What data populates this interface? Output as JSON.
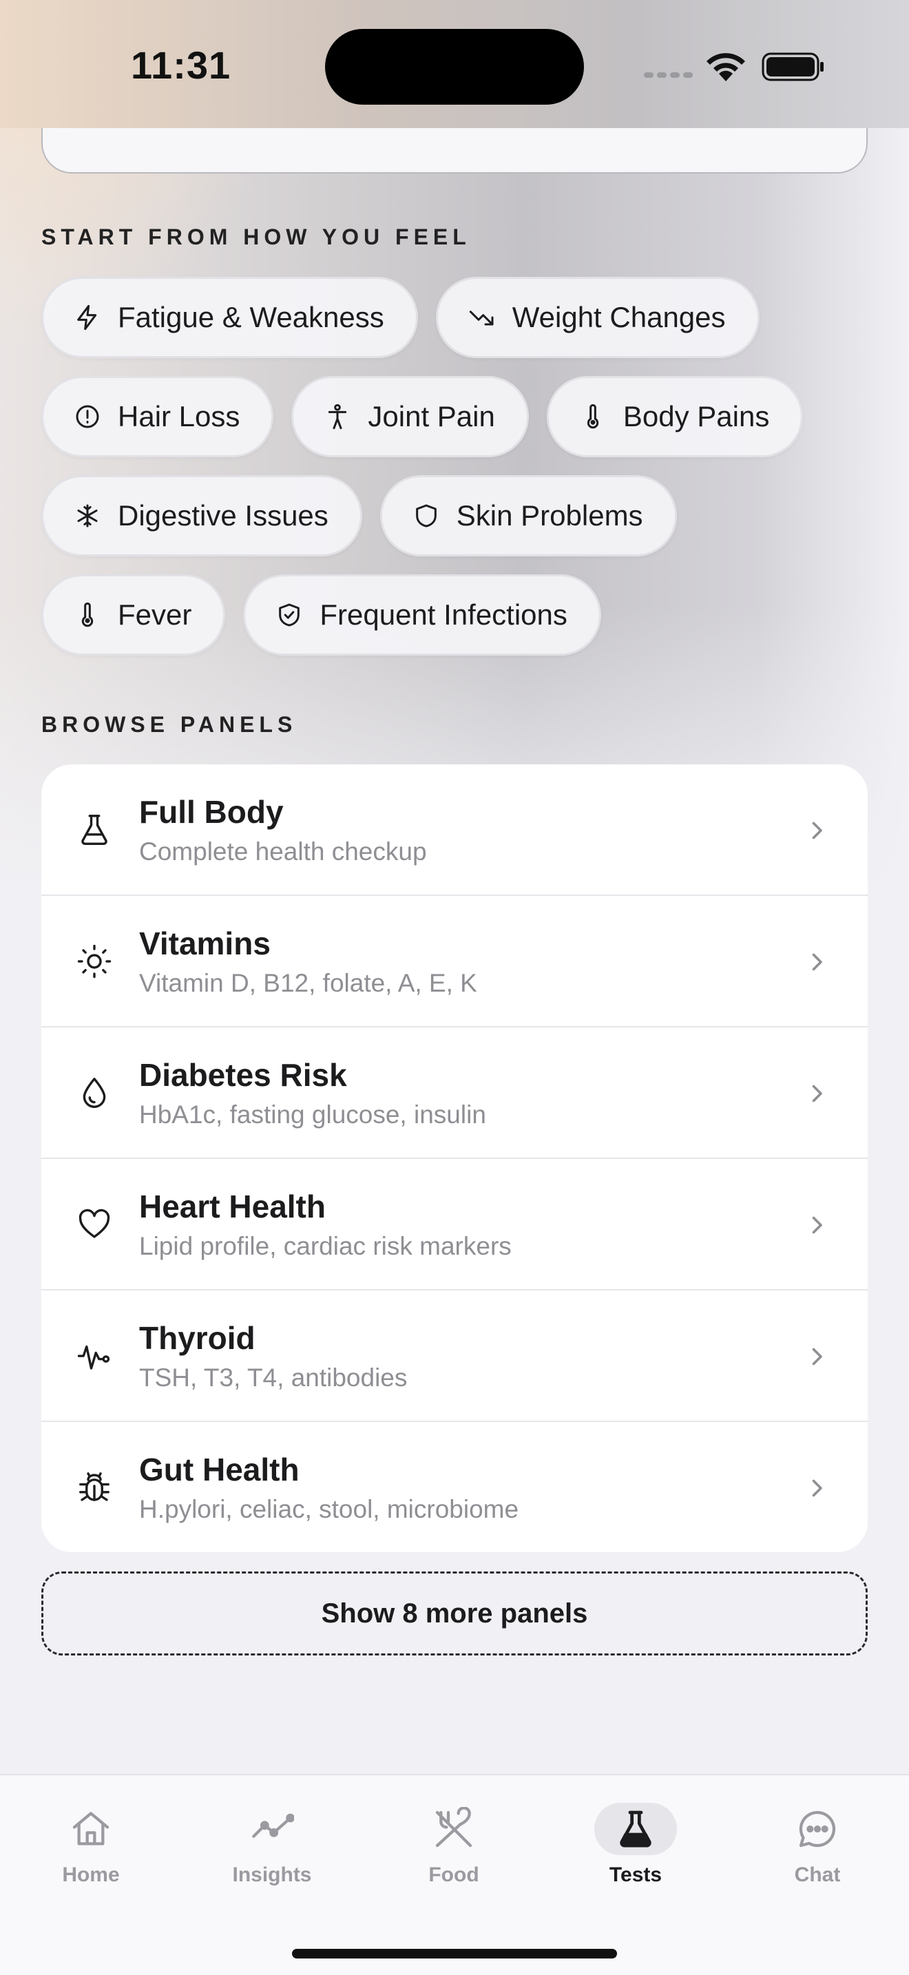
{
  "status": {
    "time": "11:31"
  },
  "symptoms": {
    "label": "START FROM HOW YOU FEEL",
    "chips": [
      {
        "label": "Fatigue & Weakness",
        "icon": "bolt-icon"
      },
      {
        "label": "Weight Changes",
        "icon": "trend-down-icon"
      },
      {
        "label": "Hair Loss",
        "icon": "alert-circle-icon"
      },
      {
        "label": "Joint Pain",
        "icon": "body-figure-icon"
      },
      {
        "label": "Body Pains",
        "icon": "thermometer-icon"
      },
      {
        "label": "Digestive Issues",
        "icon": "snowflake-icon"
      },
      {
        "label": "Skin Problems",
        "icon": "shield-icon"
      },
      {
        "label": "Fever",
        "icon": "thermometer-icon"
      },
      {
        "label": "Frequent Infections",
        "icon": "shield-check-icon"
      }
    ]
  },
  "panels": {
    "label": "BROWSE PANELS",
    "items": [
      {
        "title": "Full Body",
        "subtitle": "Complete health checkup",
        "icon": "flask-icon"
      },
      {
        "title": "Vitamins",
        "subtitle": "Vitamin D, B12, folate, A, E, K",
        "icon": "sun-icon"
      },
      {
        "title": "Diabetes Risk",
        "subtitle": "HbA1c, fasting glucose, insulin",
        "icon": "droplet-icon"
      },
      {
        "title": "Heart Health",
        "subtitle": "Lipid profile, cardiac risk markers",
        "icon": "heart-icon"
      },
      {
        "title": "Thyroid",
        "subtitle": "TSH, T3, T4, antibodies",
        "icon": "pulse-icon"
      },
      {
        "title": "Gut Health",
        "subtitle": "H.pylori, celiac, stool, microbiome",
        "icon": "bug-icon"
      }
    ],
    "more_label": "Show 8 more panels"
  },
  "tabs": [
    {
      "label": "Home",
      "icon": "home-icon",
      "active": false
    },
    {
      "label": "Insights",
      "icon": "chart-line-icon",
      "active": false
    },
    {
      "label": "Food",
      "icon": "fork-knife-icon",
      "active": false
    },
    {
      "label": "Tests",
      "icon": "flask-icon",
      "active": true
    },
    {
      "label": "Chat",
      "icon": "chat-bubble-icon",
      "active": false
    }
  ],
  "colors": {
    "text": "#1c1c1e",
    "muted": "#8e8e93",
    "background": "#f1f1f5",
    "active_tab_bg": "#e6e6ea"
  }
}
